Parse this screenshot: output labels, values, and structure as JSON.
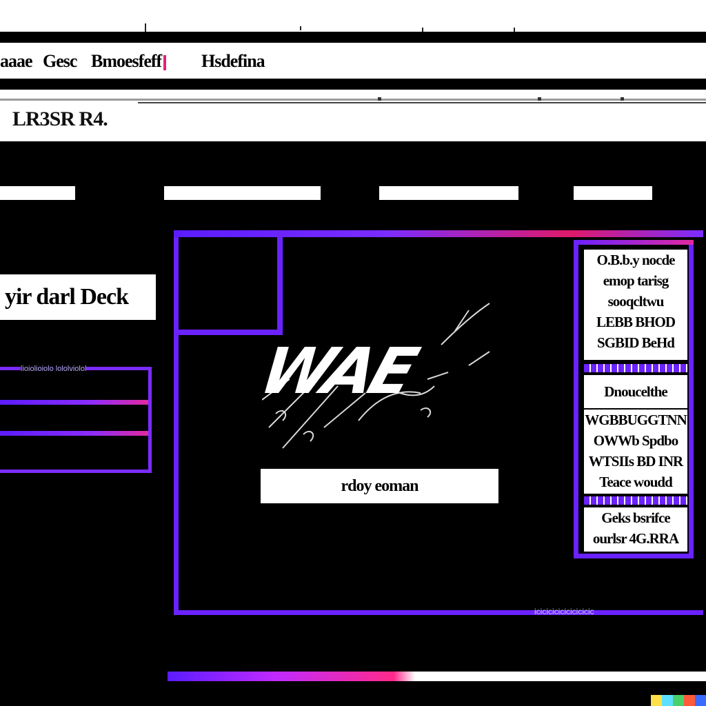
{
  "menu": {
    "items": [
      "aaae",
      "Gesc",
      "Bmoesfeff",
      "Hsdefina"
    ]
  },
  "header": {
    "subtitle": "LR3SR R4."
  },
  "nav": {
    "tabs": [
      "",
      "",
      "",
      ""
    ]
  },
  "sidebar": {
    "button_label": "yir darl Deck",
    "caption": "lioiolioiolo lololviolol"
  },
  "main": {
    "logo_text": "WAE",
    "cta_label": "rdoy eoman",
    "bottom_caption": "icicicicicicicicicic"
  },
  "right_panel": {
    "card1_lines": [
      "O.B.b.y nocde",
      "emop tarisg",
      "sooqcltwu",
      "LEBB BHOD",
      "SGBID BeHd"
    ],
    "card2_line": "Dnoucelthe",
    "card3_lines": [
      "WGBBUGGTNN",
      "OWWb Spdbo",
      "WTSIIs BD INR",
      "Teace woudd"
    ],
    "card4_lines": [
      "Geks bsrifce",
      "ourlsr 4G.RRA"
    ]
  },
  "colors": {
    "accent_purple": "#6a22ff",
    "accent_pink": "#e01a6a",
    "background": "#000000"
  }
}
